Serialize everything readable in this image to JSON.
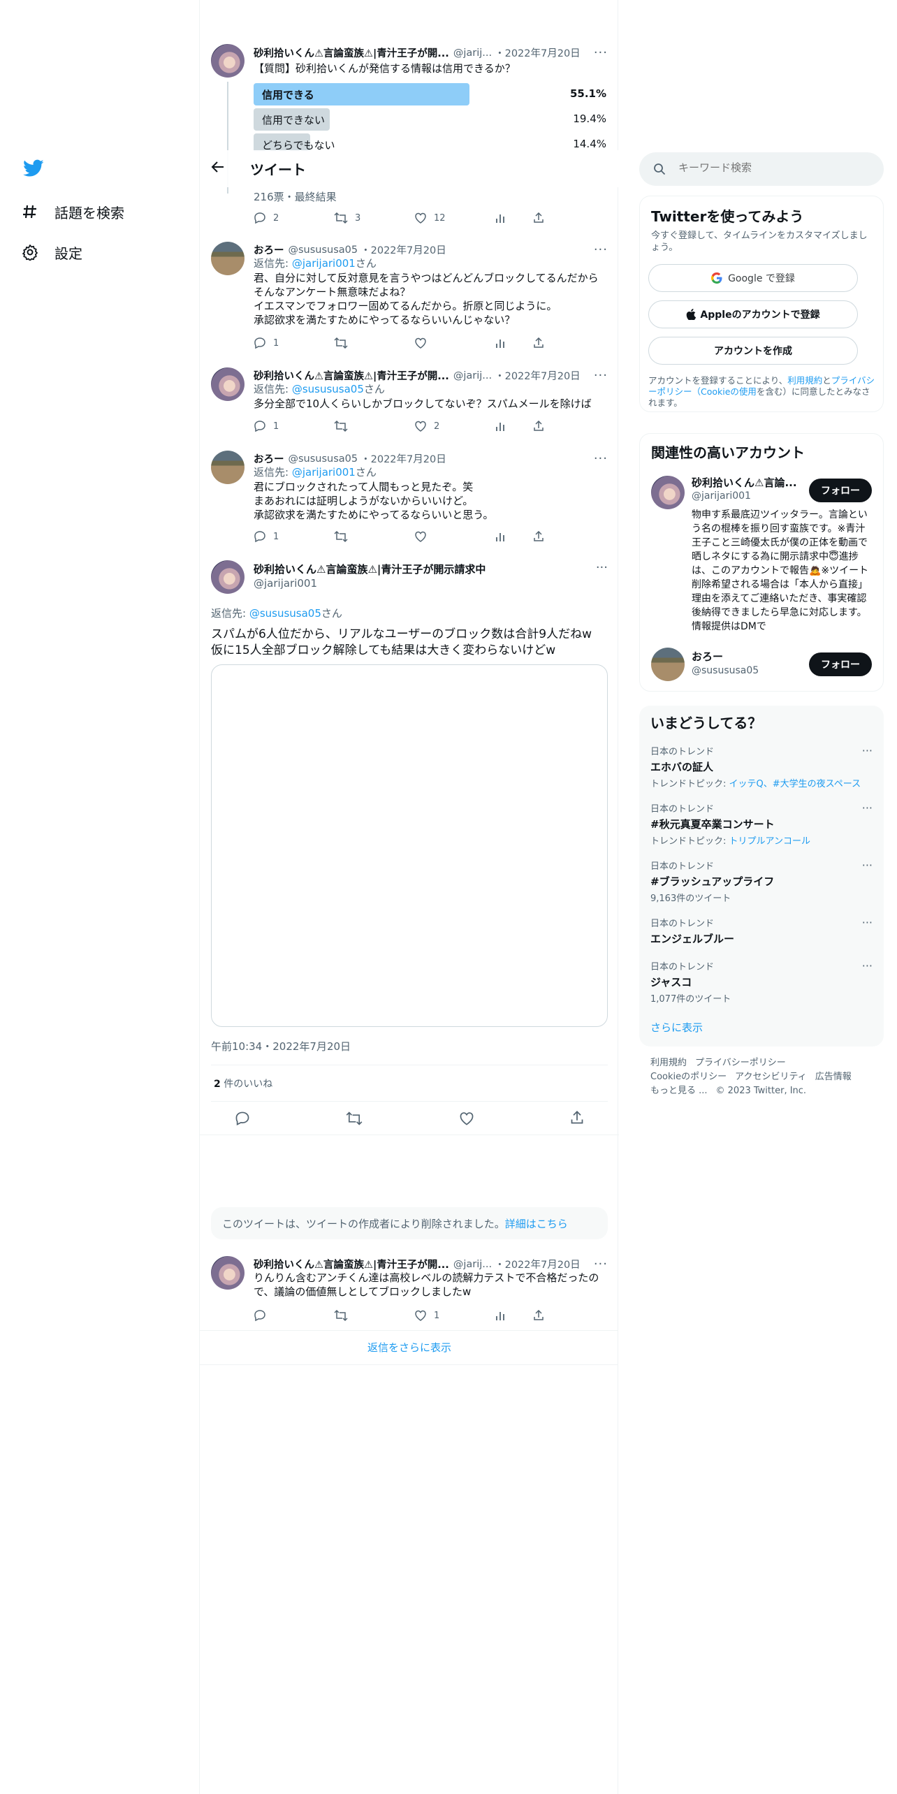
{
  "nav": {
    "items": [
      {
        "label": "話題を検索",
        "icon": "hashtag-icon"
      },
      {
        "label": "設定",
        "icon": "gear-icon"
      }
    ]
  },
  "header": {
    "title": "ツイート"
  },
  "user": {
    "name_short": "砂利拾いくん⚠言論蛮族⚠|青汁王子が開...",
    "name_full": "砂利拾いくん⚠言論蛮族⚠|青汁王子が開示請求中",
    "handle_short": "@jarij...",
    "handle": "@jarijari001"
  },
  "oro": {
    "name": "おろー",
    "handle": "@susususa05"
  },
  "poll_tweet": {
    "date": "2022年7月20日",
    "text": "【質問】砂利拾いくんが発信する情報は信用できるか？",
    "options": [
      {
        "label": "信用できる",
        "pct": "55.1%",
        "value": 55.1,
        "leading": true
      },
      {
        "label": "信用できない",
        "pct": "19.4%",
        "value": 19.4,
        "leading": false
      },
      {
        "label": "どちらでもない",
        "pct": "14.4%",
        "value": 14.4,
        "leading": false
      }
    ],
    "summary": "216票・最終結果",
    "replies": "2",
    "retweets": "3",
    "likes": "12"
  },
  "reply1": {
    "date": "2022年7月20日",
    "reply_prefix": "返信先: ",
    "reply_to": "@jarijari001",
    "reply_suffix": "さん",
    "lines": [
      "君、自分に対して反対意見を言うやつはどんどんブロックしてるんだから",
      "そんなアンケート無意味だよね？",
      "イエスマンでフォロワー固めてるんだから。折原と同じように。",
      "承認欲求を満たすためにやってるならいいんじゃない？"
    ],
    "replies": "1"
  },
  "reply2": {
    "date": "2022年7月20日",
    "reply_prefix": "返信先: ",
    "reply_to": "@susususa05",
    "reply_suffix": "さん",
    "text": "多分全部で10人くらいしかブロックしてないぞ？スパムメールを除けば",
    "replies": "1",
    "likes": "2"
  },
  "reply3": {
    "date": "2022年7月20日",
    "reply_prefix": "返信先: ",
    "reply_to": "@jarijari001",
    "reply_suffix": "さん",
    "lines": [
      "君にブロックされたって人間もっと見たぞ。笑",
      "まあおれには証明しようがないからいいけど。",
      "承認欲求を満たすためにやってるならいいと思う。"
    ],
    "replies": "1"
  },
  "main_tweet": {
    "reply_prefix": "返信先: ",
    "reply_to": "@susususa05",
    "reply_suffix": "さん",
    "lines": [
      "スパムが6人位だから、リアルなユーザーのブロック数は合計9人だねw",
      "仮に15人全部ブロック解除しても結果は大きく変わらないけどw"
    ],
    "timestamp": "午前10:34・2022年7月20日",
    "likes_count": "2",
    "likes_label": " 件のいいね"
  },
  "deleted_notice": {
    "text": "このツイートは、ツイートの作成者により削除されました。",
    "link": "詳細はこちら"
  },
  "last_tweet": {
    "date": "2022年7月20日",
    "lines": [
      "りんりん含むアンチくん達は高校レベルの読解力テストで不合格だったの",
      "で、議論の価値無しとしてブロックしましたw"
    ],
    "likes": "1"
  },
  "show_more_replies": "返信をさらに表示",
  "search": {
    "placeholder": "キーワード検索"
  },
  "signup": {
    "title": "Twitterを使ってみよう",
    "desc": "今すぐ登録して、タイムラインをカスタマイズしましょう。",
    "google": "Google で登録",
    "apple": "Appleのアカウントで登録",
    "create": "アカウントを作成",
    "terms_pre": "アカウントを登録することにより、",
    "terms_link1": "利用規約",
    "terms_mid": "と",
    "terms_link2": "プライバシーポリシー（Cookieの使用",
    "terms_post": "を含む）に同意したとみなされます。"
  },
  "related": {
    "title": "関連性の高いアカウント",
    "acc1_name": "砂利拾いくん⚠言論...",
    "acc1_handle": "@jarijari001",
    "acc1_bio": "物申す系最底辺ツイッタラー。言論という名の棍棒を振り回す蛮族です。※青汁王子こと三崎優太氏が僕の正体を動画で晒しネタにする為に開示請求中😇進捗は、このアカウントで報告🙇※ツイート削除希望される場合は「本人から直接」理由を添えてご連絡いただき、事実確認後納得できましたら早急に対応します。情報提供はDMで",
    "acc2_name": "おろー",
    "acc2_handle": "@susususa05",
    "follow": "フォロー"
  },
  "trends": {
    "title": "いまどうしてる？",
    "items": [
      {
        "context": "日本のトレンド",
        "name": "エホバの証人",
        "sub_pre": "トレンドトピック: ",
        "sub_link": "イッテQ、#大学生の夜スペース",
        "sub_plain": ""
      },
      {
        "context": "日本のトレンド",
        "name": "#秋元真夏卒業コンサート",
        "sub_pre": "トレンドトピック: ",
        "sub_link": "トリプルアンコール",
        "sub_plain": ""
      },
      {
        "context": "日本のトレンド",
        "name": "#ブラッシュアップライフ",
        "sub_pre": "",
        "sub_link": "",
        "sub_plain": "9,163件のツイート"
      },
      {
        "context": "日本のトレンド",
        "name": "エンジェルブルー",
        "sub_pre": "",
        "sub_link": "",
        "sub_plain": ""
      },
      {
        "context": "日本のトレンド",
        "name": "ジャスコ",
        "sub_pre": "",
        "sub_link": "",
        "sub_plain": "1,077件のツイート"
      }
    ],
    "show_more": "さらに表示"
  },
  "footer": {
    "links": [
      "利用規約",
      "プライバシーポリシー",
      "Cookieのポリシー",
      "アクセシビリティ",
      "広告情報",
      "もっと見る ...",
      "© 2023 Twitter, Inc."
    ]
  },
  "colors": {
    "brand": "#1d9bf0",
    "poll_leading": "#8ecdf8",
    "poll_other": "#cfd9de",
    "text": "#0f1419",
    "muted": "#536471"
  }
}
